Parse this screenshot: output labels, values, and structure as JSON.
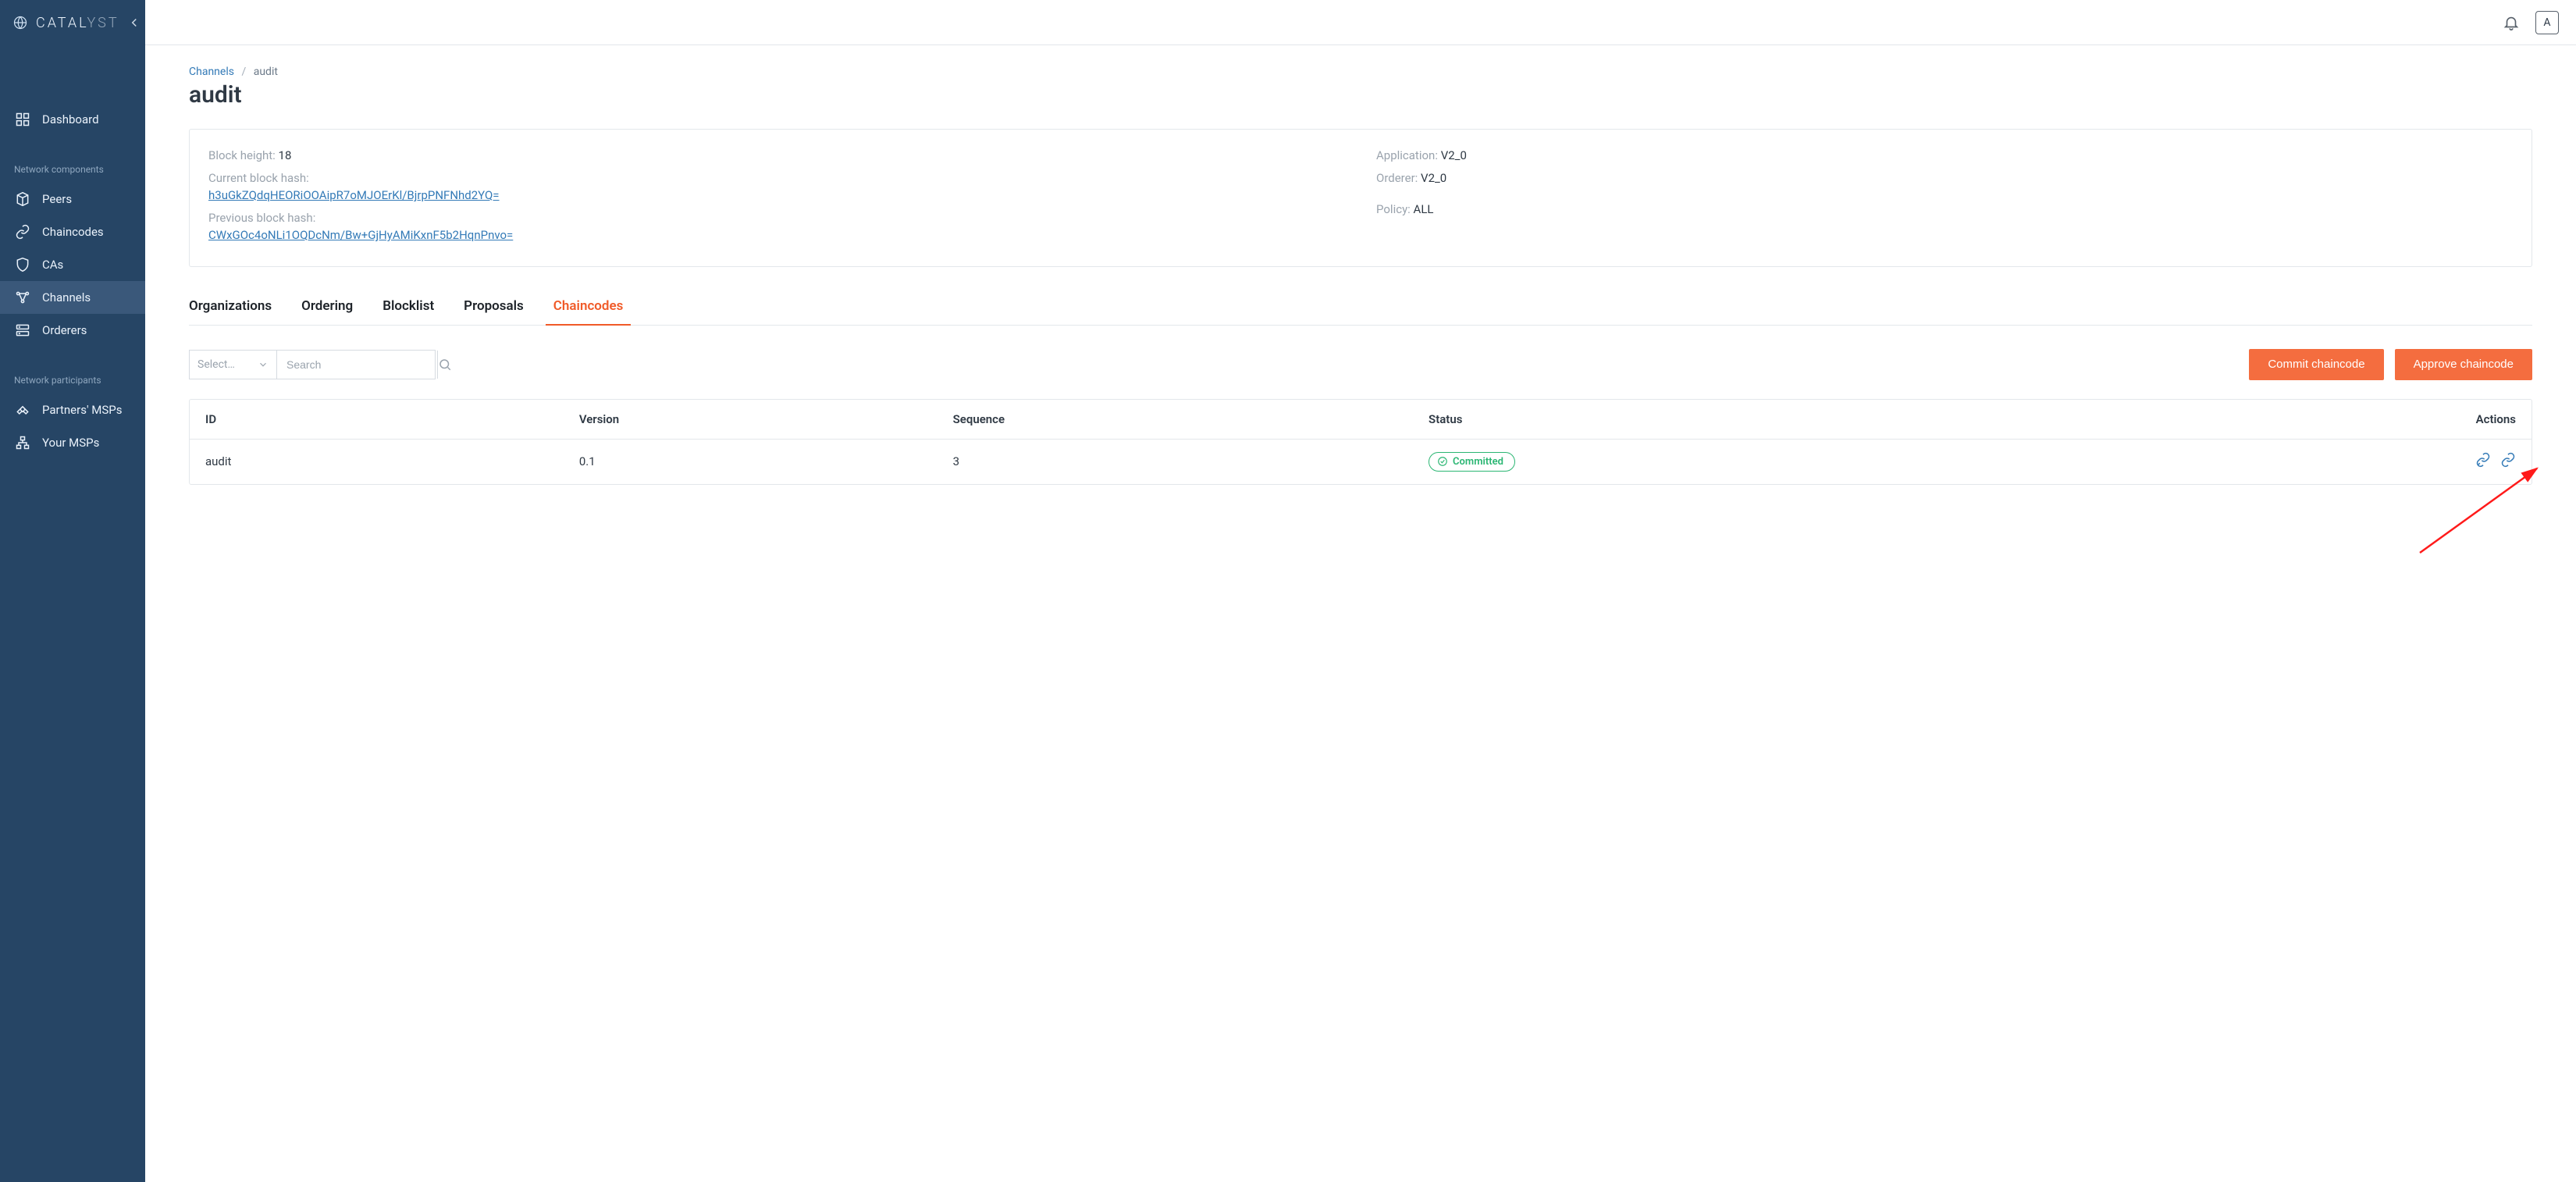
{
  "app": {
    "logo_primary": "CATAL",
    "logo_secondary": "YST",
    "avatar_initial": "A"
  },
  "sidebar": {
    "dashboard": "Dashboard",
    "group_components": "Network components",
    "peers": "Peers",
    "chaincodes": "Chaincodes",
    "cas": "CAs",
    "channels": "Channels",
    "orderers": "Orderers",
    "group_participants": "Network participants",
    "partners_msps": "Partners' MSPs",
    "your_msps": "Your MSPs"
  },
  "breadcrumb": {
    "root": "Channels",
    "current": "audit"
  },
  "page": {
    "title": "audit"
  },
  "details": {
    "block_height_label": "Block height:",
    "block_height_value": "18",
    "current_hash_label": "Current block hash:",
    "current_hash_value": "h3uGkZQdqHEORiOOAipR7oMJOErKl/BjrpPNFNhd2YQ=",
    "previous_hash_label": "Previous block hash:",
    "previous_hash_value": "CWxGOc4oNLi1OQDcNm/Bw+GjHyAMiKxnF5b2HqnPnvo=",
    "application_label": "Application:",
    "application_value": "V2_0",
    "orderer_label": "Orderer:",
    "orderer_value": "V2_0",
    "policy_label": "Policy:",
    "policy_value": "ALL"
  },
  "tabs": {
    "organizations": "Organizations",
    "ordering": "Ordering",
    "blocklist": "Blocklist",
    "proposals": "Proposals",
    "chaincodes": "Chaincodes"
  },
  "filters": {
    "select_placeholder": "Select…",
    "search_placeholder": "Search"
  },
  "actions": {
    "commit": "Commit chaincode",
    "approve": "Approve chaincode"
  },
  "table": {
    "headers": {
      "id": "ID",
      "version": "Version",
      "sequence": "Sequence",
      "status": "Status",
      "actions": "Actions"
    },
    "rows": [
      {
        "id": "audit",
        "version": "0.1",
        "sequence": "3",
        "status": "Committed"
      }
    ]
  }
}
